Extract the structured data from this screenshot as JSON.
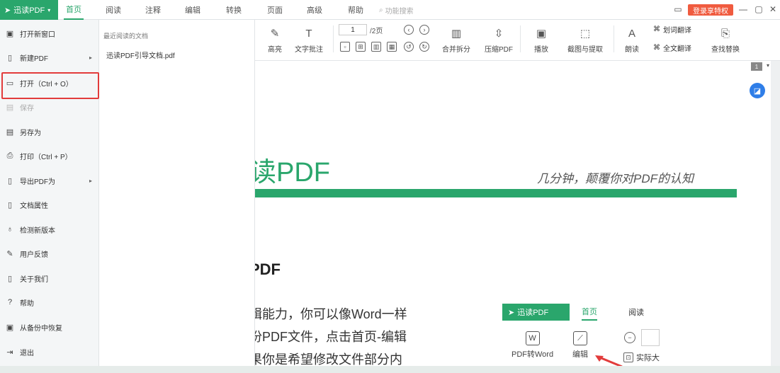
{
  "app": {
    "brand": "迅读PDF",
    "brand_arrow": "▾"
  },
  "menu_tabs": [
    "首页",
    "阅读",
    "注释",
    "编辑",
    "转换",
    "页面",
    "高级",
    "帮助"
  ],
  "search": {
    "placeholder": "功能搜索"
  },
  "login_label": "登录享特权",
  "toolbar": {
    "highlight": "高亮",
    "text_note": "文字批注",
    "page_current": "1",
    "page_total": "/2页",
    "merge_split": "合并拆分",
    "compress": "压缩PDF",
    "play": "播放",
    "screenshot_extract": "截图与提取",
    "read_aloud": "朗读",
    "translate_selection": "划词翻译",
    "full_translate": "全文翻译",
    "find_replace": "查找替换"
  },
  "left_menu": [
    {
      "label": "打开新窗口"
    },
    {
      "label": "新建PDF"
    },
    {
      "label": "打开（Ctrl + O）"
    },
    {
      "label": "保存"
    },
    {
      "label": "另存为"
    },
    {
      "label": "打印（Ctrl + P）"
    },
    {
      "label": "导出PDF为"
    },
    {
      "label": "文档属性"
    },
    {
      "label": "检测新版本"
    },
    {
      "label": "用户反馈"
    },
    {
      "label": "关于我们"
    },
    {
      "label": "帮助"
    },
    {
      "label": "从备份中恢复"
    },
    {
      "label": "退出"
    }
  ],
  "recent": {
    "title": "最近阅读的文档",
    "file": "迅读PDF引导文档.pdf"
  },
  "document": {
    "page_number": "1",
    "hero_title": "读PDF",
    "slogan": "几分钟，颠覆你对PDF的认知",
    "heading": "PDF",
    "para1": "辑能力，你可以像Word一样",
    "para2": "份PDF文件，点击首页-编辑",
    "para3": "果你是希望修改文件部分内",
    "mock_brand": "迅读PDF",
    "mock_tab_home": "首页",
    "mock_tab_read": "阅读",
    "mock_pdf2word": "PDF转Word",
    "mock_edit": "编辑",
    "mock_actual": "实际大"
  },
  "colors": {
    "brand": "#2aa66c",
    "accent_red": "#e23b3b",
    "login": "#f05b3f"
  }
}
